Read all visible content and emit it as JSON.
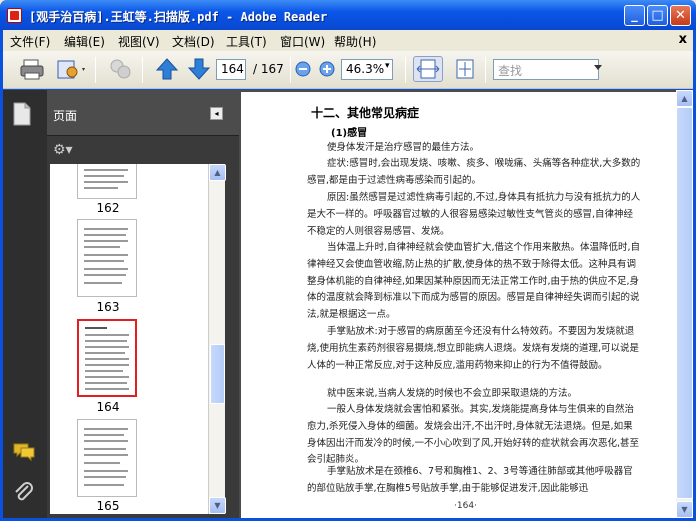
{
  "window": {
    "title": "[观手治百病].王虹等.扫描版.pdf - Adobe Reader"
  },
  "titlebar_buttons": {
    "minimize": "_",
    "maximize": "□",
    "close": "✕"
  },
  "menu": {
    "items": [
      "文件(F)",
      "编辑(E)",
      "视图(V)",
      "文档(D)",
      "工具(T)",
      "窗口(W)",
      "帮助(H)"
    ],
    "doc_close": "x"
  },
  "toolbar": {
    "page_value": "164",
    "page_total": "/ 167",
    "zoom_value": "46.3%",
    "search_placeholder": "查找",
    "dropdown_glyph": "▾"
  },
  "pane": {
    "title": "页面",
    "collapse_glyph": "◂",
    "options_glyph": "⚙▾",
    "thumbnails": [
      {
        "label": "162"
      },
      {
        "label": "163"
      },
      {
        "label": "164"
      },
      {
        "label": "165"
      }
    ],
    "selected_page": "164"
  },
  "document": {
    "heading": "十二、其他常见病症",
    "subheading": "(1)感冒",
    "paragraphs": [
      "使身体发汗是治疗感冒的最佳方法。",
      "症状:感冒时,会出现发烧、咳嗽、痰多、喉咙痛、头痛等各种症状,大多数的感冒,都是由于过滤性病毒感染而引起的。",
      "原因:虽然感冒是过滤性病毒引起的,不过,身体具有抵抗力与没有抵抗力的人是大不一样的。呼吸器官过敏的人很容易感染过敏性支气管炎的感冒,自律神经不稳定的人则很容易感冒、发烧。",
      "当体温上升时,自律神经就会使血管扩大,借这个作用来散热。体温降低时,自律神经又会使血管收缩,防止热的扩散,使身体的热不致于除得太低。这种具有调整身体机能的自律神经,如果因某种原因而无法正常工作时,由于热的供应不足,身体的温度就会降到标准以下而成为感冒的原因。感冒是自律神经失调而引起的说法,就是根据这一点。",
      "手掌贴放术:对于感冒的病原菌至今还没有什么特效药。不要因为发烧就退烧,使用抗生素药剂很容易摄烧,想立即能病人退烧。发烧有发烧的道理,可以说是人体的一种正常反应,对于这种反应,滥用药物来抑止的行为不值得鼓励。",
      "就中医来说,当病人发烧的时候也不会立即采取退烧的方法。",
      "一般人身体发烧就会害怕和紧张。其实,发烧能提高身体与生俱来的自然治愈力,杀死侵入身体的细菌。发烧会出汗,不出汗时,身体就无法退烧。但是,如果身体因出汗而发冷的时候,一不小心吹到了风,开始好转的症状就会再次恶化,甚至会引起肺炎。",
      "手掌贴放术是在颈椎6、7号和胸椎1、2、3号等通往肺部或其他呼吸器官的部位贴放手掌,在胸椎5号贴放手掌,由于能够促进发汗,因此能够迅"
    ],
    "page_footer": "·164·"
  },
  "scroll": {
    "up": "▲",
    "down": "▼"
  }
}
